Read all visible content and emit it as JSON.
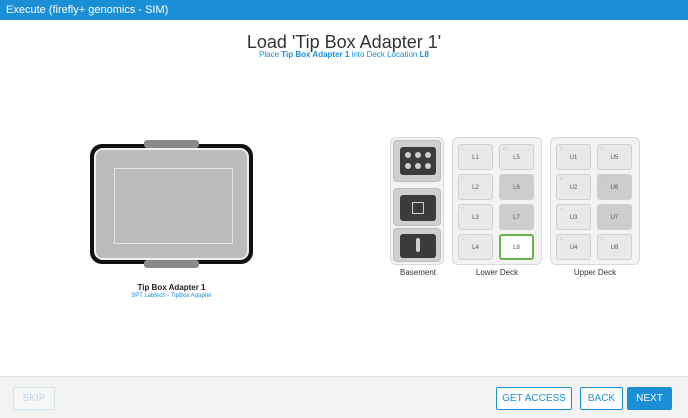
{
  "window": {
    "title": "Execute (firefly+ genomics - SIM)"
  },
  "header": {
    "title": "Load 'Tip Box Adapter 1'",
    "subtitle_prefix": "Place ",
    "subtitle_item": "Tip Box Adapter 1",
    "subtitle_mid": " into Deck Location ",
    "subtitle_location": "L8"
  },
  "adapter": {
    "name": "Tip Box Adapter 1",
    "description": "SPT Labtech - TipBox Adapter"
  },
  "deck": {
    "basement_label": "Basement",
    "lower_label": "Lower Deck",
    "upper_label": "Upper Deck",
    "lower_slots": [
      "L1",
      "L5",
      "L2",
      "L6",
      "L3",
      "L7",
      "L4",
      "L8"
    ],
    "upper_slots": [
      "U1",
      "U5",
      "U2",
      "U6",
      "U3",
      "U7",
      "U4",
      "U8"
    ],
    "active_slot": "L8"
  },
  "footer": {
    "skip": "SKIP",
    "get_access": "GET ACCESS",
    "back": "BACK",
    "next": "NEXT"
  },
  "colors": {
    "accent": "#1a8fd6",
    "active_slot_border": "#6ab04c"
  }
}
